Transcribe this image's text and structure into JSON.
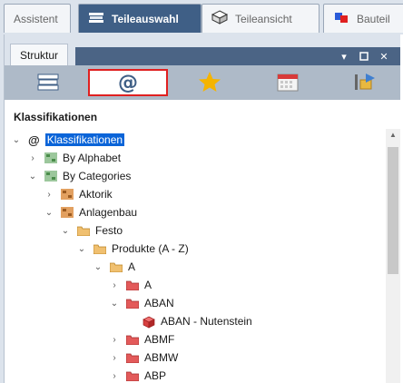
{
  "tabs": [
    {
      "label": "Assistent",
      "active": false
    },
    {
      "label": "Teileauswahl",
      "active": true
    },
    {
      "label": "Teileansicht",
      "active": false
    },
    {
      "label": "Bauteil",
      "active": false
    }
  ],
  "panel": {
    "title": "Struktur",
    "buttons": [
      "pin",
      "restore",
      "close"
    ],
    "toolbar": [
      {
        "name": "books-icon"
      },
      {
        "name": "at-icon",
        "text": "@",
        "selected": true
      },
      {
        "name": "star-icon"
      },
      {
        "name": "calendar-icon"
      },
      {
        "name": "export-icon"
      }
    ],
    "section_title": "Klassifikationen"
  },
  "tree": [
    {
      "label": "Klassifikationen",
      "prefix": "@",
      "expanded": true,
      "selected": true,
      "icon": "at"
    },
    {
      "label": "By Alphabet",
      "expanded": false,
      "icon": "grid-green"
    },
    {
      "label": "By Categories",
      "expanded": true,
      "icon": "grid-green"
    },
    {
      "label": "Aktorik",
      "expanded": false,
      "icon": "grid-orange"
    },
    {
      "label": "Anlagenbau",
      "expanded": true,
      "icon": "grid-orange"
    },
    {
      "label": "Festo",
      "expanded": true,
      "icon": "folder-open"
    },
    {
      "label": "Produkte (A - Z)",
      "expanded": true,
      "icon": "folder-open"
    },
    {
      "label": "A",
      "expanded": true,
      "icon": "folder-open"
    },
    {
      "label": "A",
      "expanded": false,
      "icon": "folder-red"
    },
    {
      "label": "ABAN",
      "expanded": true,
      "icon": "folder-red"
    },
    {
      "label": "ABAN - Nutenstein",
      "expanded": null,
      "icon": "part-cube"
    },
    {
      "label": "ABMF",
      "expanded": false,
      "icon": "folder-red"
    },
    {
      "label": "ABMW",
      "expanded": false,
      "icon": "folder-red"
    },
    {
      "label": "ABP",
      "expanded": false,
      "icon": "folder-red"
    }
  ],
  "colors": {
    "accent": "#3f5f86",
    "selection": "#0a64d8",
    "highlight_border": "#e02020"
  }
}
